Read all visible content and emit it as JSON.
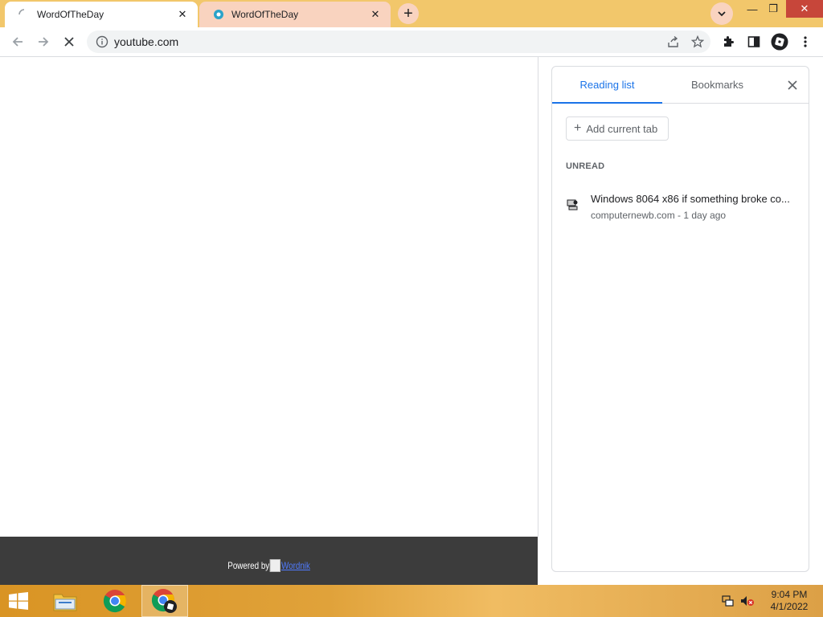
{
  "browser": {
    "tabs": [
      {
        "title": "WordOfTheDay",
        "active": true,
        "loading": true
      },
      {
        "title": "WordOfTheDay",
        "active": false,
        "loading": false
      }
    ],
    "window_controls": {
      "minimize": "—",
      "restore": "❐",
      "close": "✕"
    },
    "address_bar": {
      "url": "youtube.com"
    },
    "accent_color": "#1a73e8",
    "tabstrip_color": "#f2c76b"
  },
  "page": {
    "footer": {
      "powered_by": "Powered by",
      "logo_link": "Wordnik"
    }
  },
  "side_panel": {
    "tabs": [
      "Reading list",
      "Bookmarks"
    ],
    "active_tab": "Reading list",
    "add_current_tab": "Add current tab",
    "section_label": "UNREAD",
    "items": [
      {
        "title": "Windows 8064 x86 if something broke co...",
        "meta": "computernewb.com - 1 day ago"
      }
    ]
  },
  "taskbar": {
    "clock": {
      "time": "9:04 PM",
      "date": "4/1/2022"
    }
  }
}
